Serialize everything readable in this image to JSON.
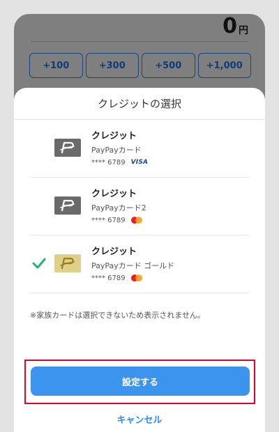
{
  "background": {
    "amount_value": "0",
    "amount_unit": "円",
    "quick_amounts": [
      "+100",
      "+300",
      "+500",
      "+1,000"
    ]
  },
  "sheet": {
    "title": "クレジットの選択",
    "cards": [
      {
        "name": "クレジット",
        "product": "PayPayカード",
        "number": "**** 6789",
        "brand": "VISA",
        "selected": false,
        "style": "gray"
      },
      {
        "name": "クレジット",
        "product": "PayPayカード2",
        "number": "**** 6789",
        "brand": "mastercard-icon",
        "selected": false,
        "style": "gray"
      },
      {
        "name": "クレジット",
        "product": "PayPayカード ゴールド",
        "number": "**** 6789",
        "brand": "mastercard-icon",
        "selected": true,
        "style": "gold"
      }
    ],
    "note": "※家族カードは選択できないため表示されません。",
    "confirm_label": "設定する",
    "cancel_label": "キャンセル"
  },
  "colors": {
    "accent": "#3d94ee",
    "highlight": "#e4002b",
    "check": "#21b573"
  }
}
